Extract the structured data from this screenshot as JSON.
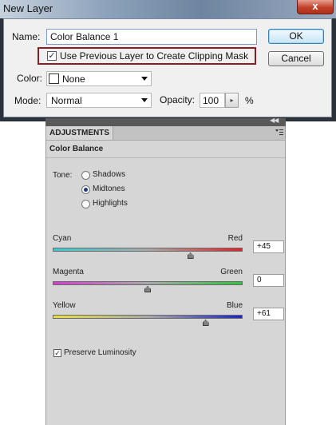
{
  "dialog": {
    "title": "New Layer",
    "close_label": "x",
    "name_label": "Name:",
    "name_value": "Color Balance 1",
    "clip_checked": true,
    "clip_label": "Use Previous Layer to Create Clipping Mask",
    "color_label": "Color:",
    "color_value": "None",
    "mode_label": "Mode:",
    "mode_value": "Normal",
    "opacity_label": "Opacity:",
    "opacity_value": "100",
    "opacity_unit": "%",
    "ok_label": "OK",
    "cancel_label": "Cancel",
    "highlight_color": "#8a1e22"
  },
  "panel": {
    "tab_label": "ADJUSTMENTS",
    "title": "Color Balance",
    "tone_label": "Tone:",
    "tones": [
      {
        "label": "Shadows",
        "selected": false
      },
      {
        "label": "Midtones",
        "selected": true
      },
      {
        "label": "Highlights",
        "selected": false
      }
    ],
    "sliders": [
      {
        "left": "Cyan",
        "right": "Red",
        "value": "+45",
        "level": 45,
        "gradient": [
          "#3ccad2",
          "#e02424"
        ]
      },
      {
        "left": "Magenta",
        "right": "Green",
        "value": "0",
        "level": 0,
        "gradient": [
          "#d83ad4",
          "#2ec43a"
        ]
      },
      {
        "left": "Yellow",
        "right": "Blue",
        "value": "+61",
        "level": 61,
        "gradient": [
          "#e8e23a",
          "#1a24c8"
        ]
      }
    ],
    "preserve_luminosity_checked": true,
    "preserve_luminosity_label": "Preserve Luminosity"
  }
}
